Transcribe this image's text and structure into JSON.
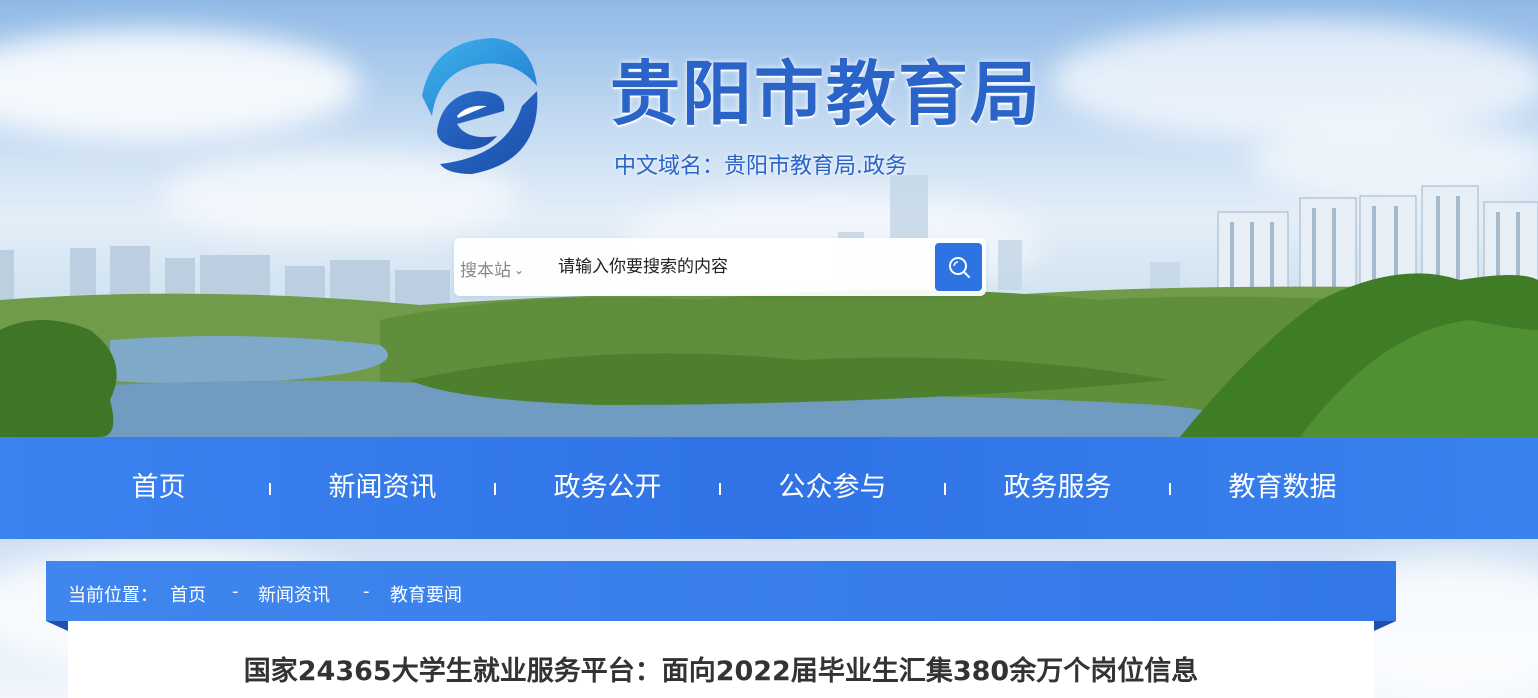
{
  "header": {
    "site_title": "贵阳市教育局",
    "domain_label": "中文域名：贵阳市教育局.政务"
  },
  "search": {
    "scope_label": "搜本站",
    "placeholder": "请输入你要搜索的内容"
  },
  "nav": {
    "items": [
      {
        "label": "首页"
      },
      {
        "label": "新闻资讯"
      },
      {
        "label": "政务公开"
      },
      {
        "label": "公众参与"
      },
      {
        "label": "政务服务"
      },
      {
        "label": "教育数据"
      }
    ]
  },
  "breadcrumb": {
    "prefix": "当前位置：",
    "items": [
      "首页",
      "新闻资讯",
      "教育要闻"
    ],
    "separator": "-"
  },
  "article": {
    "title": "国家24365大学生就业服务平台：面向2022届毕业生汇集380余万个岗位信息"
  },
  "colors": {
    "brand_blue": "#2f73e6",
    "title_blue": "#2a64c8",
    "search_button": "#2d74e2"
  }
}
